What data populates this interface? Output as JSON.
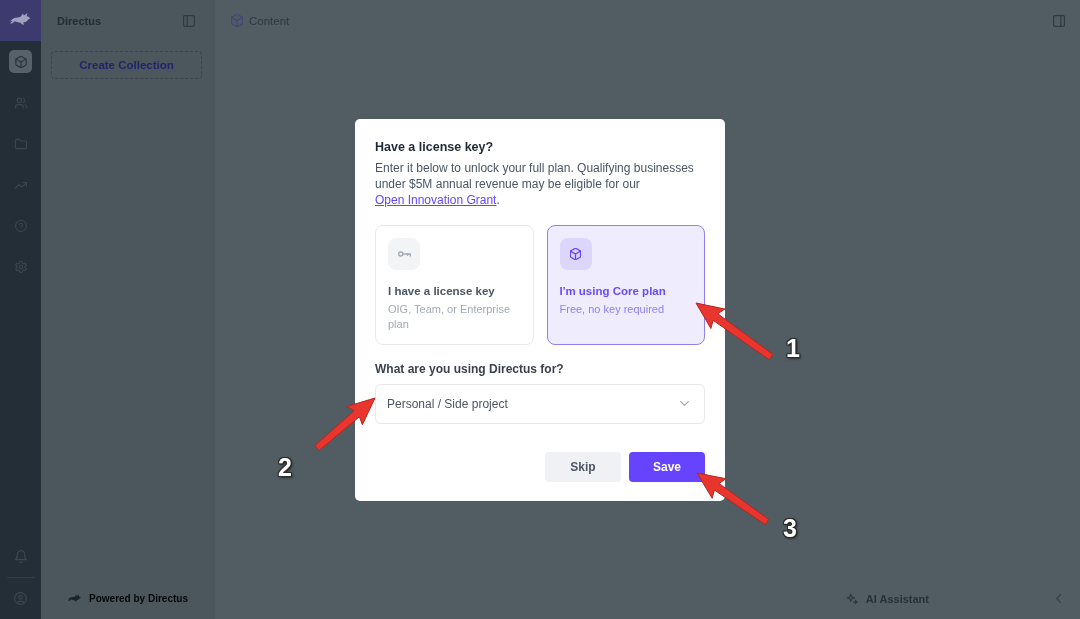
{
  "rail": {
    "items": [
      {
        "selected": true
      },
      {
        "selected": false
      },
      {
        "selected": false
      },
      {
        "selected": false
      },
      {
        "selected": false
      },
      {
        "selected": false
      }
    ]
  },
  "navigation": {
    "title": "Directus",
    "create_button": "Create Collection",
    "footer": "Powered by Directus"
  },
  "header": {
    "title": "Content"
  },
  "footer": {
    "ai_assistant": "AI Assistant"
  },
  "dialog": {
    "title": "Have a license key?",
    "description": "Enter it below to unlock your full plan. Qualifying businesses under $5M annual revenue may be eligible for our",
    "link": "Open Innovation Grant",
    "description_end": ".",
    "plans": [
      {
        "title": "I have a license key",
        "subtitle": "OIG, Team, or Enterprise plan",
        "selected": false
      },
      {
        "title": "I'm using Core plan",
        "subtitle": "Free, no key required",
        "selected": true
      }
    ],
    "usage_label": "What are you using Directus for?",
    "usage_select": {
      "value": "Personal / Side project"
    },
    "buttons": [
      {
        "label": "Skip",
        "kind": "secondary"
      },
      {
        "label": "Save",
        "kind": "primary"
      }
    ]
  },
  "annotations": [
    {
      "label": "1"
    },
    {
      "label": "2"
    },
    {
      "label": "3"
    }
  ]
}
